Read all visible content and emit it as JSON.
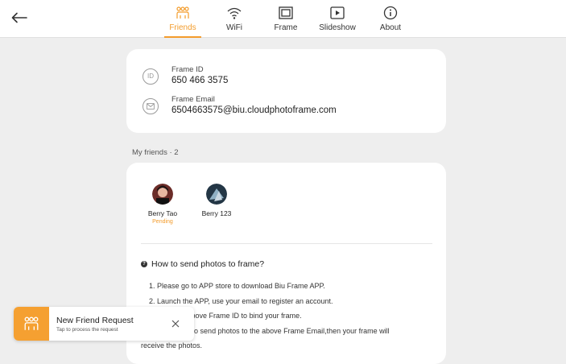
{
  "nav": {
    "back_icon": "arrow-left-icon",
    "tabs": [
      {
        "label": "Friends",
        "icon": "friends-icon",
        "active": true
      },
      {
        "label": "WiFi",
        "icon": "wifi-icon",
        "active": false
      },
      {
        "label": "Frame",
        "icon": "frame-icon",
        "active": false
      },
      {
        "label": "Slideshow",
        "icon": "slideshow-icon",
        "active": false
      },
      {
        "label": "About",
        "icon": "info-icon",
        "active": false
      }
    ]
  },
  "frame_info": {
    "id_label": "Frame ID",
    "id_value": "650 466 3575",
    "email_label": "Frame Email",
    "email_value": "6504663575@biu.cloudphotoframe.com"
  },
  "friends": {
    "title": "My friends · 2",
    "list": [
      {
        "name": "Berry Tao",
        "status": "Pending"
      },
      {
        "name": "Berry 123",
        "status": ""
      }
    ]
  },
  "howto": {
    "title": "How to send photos to frame?",
    "steps": [
      "1. Please go to APP store to download Biu Frame APP.",
      "2. Launch the APP, use your email to register an account.",
      "3. Input the above Frame ID to bind your frame.",
      "4. You can also send photos to the above Frame Email,then your frame will",
      "receive the photos."
    ]
  },
  "toast": {
    "title": "New Friend Request",
    "subtitle": "Tap to process the request"
  },
  "colors": {
    "accent": "#f39c2c",
    "background": "#eeeeee"
  }
}
